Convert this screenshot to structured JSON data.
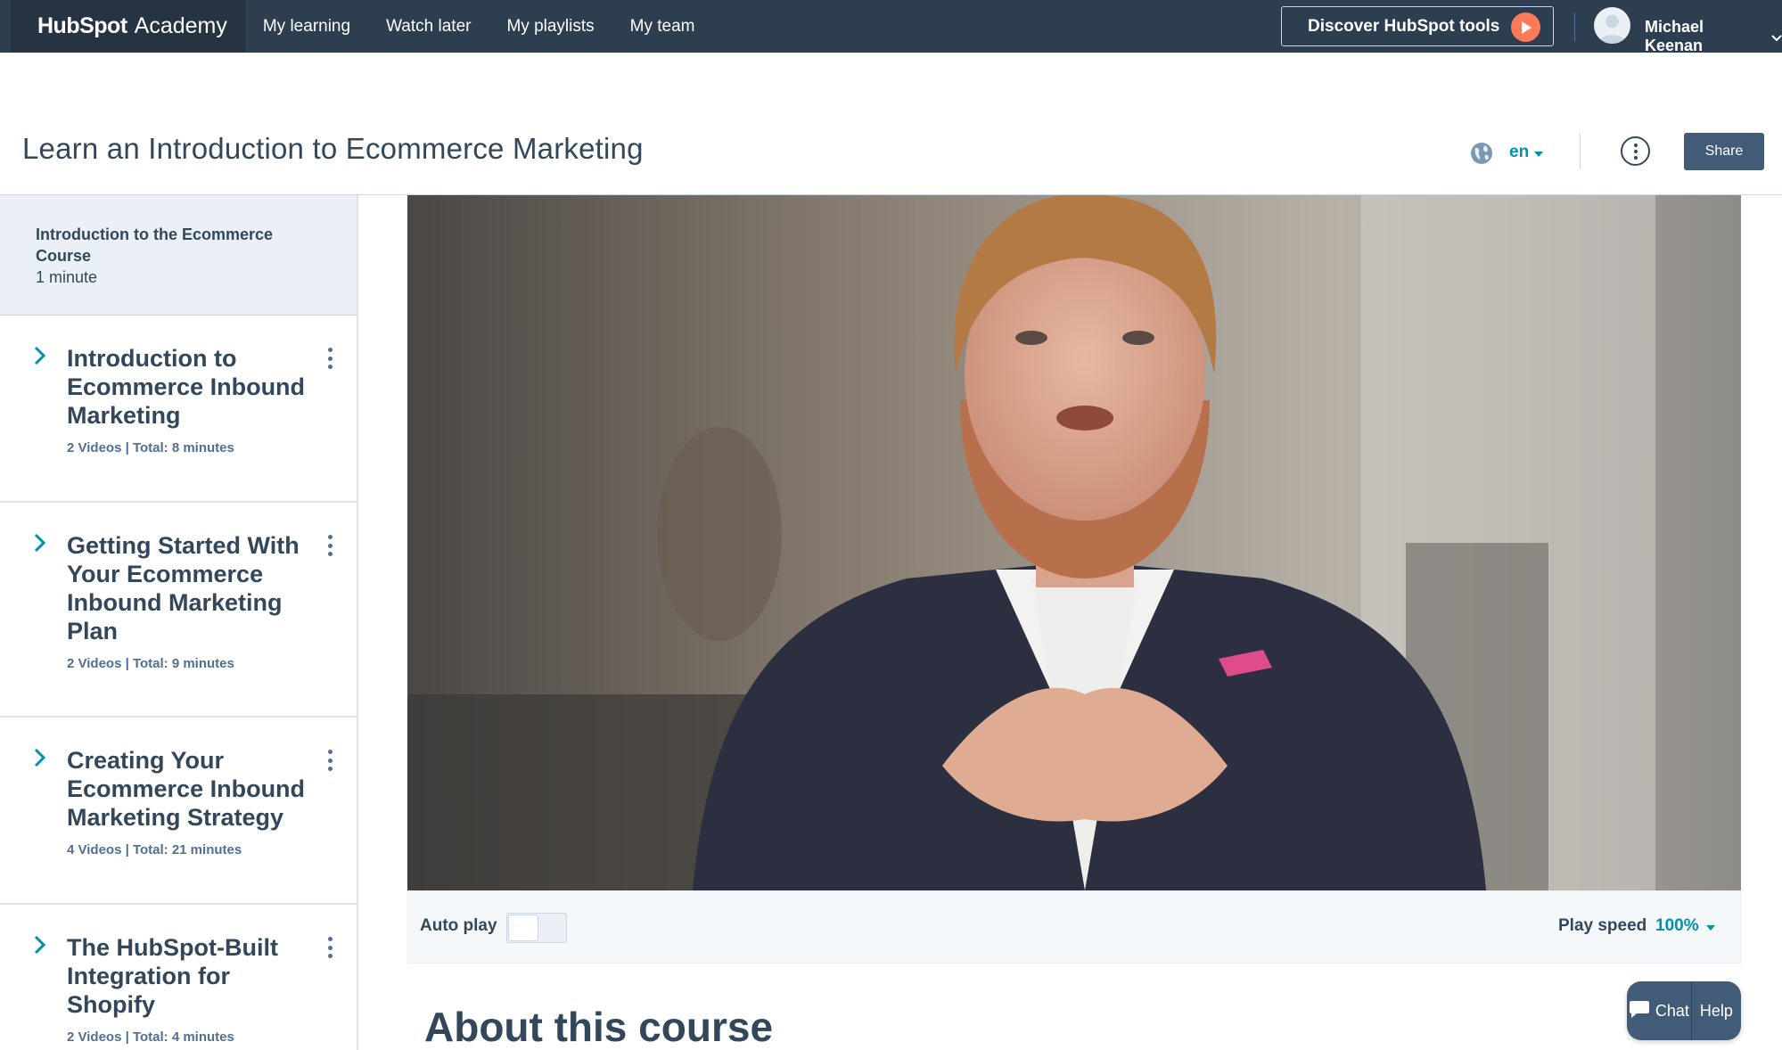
{
  "topnav": {
    "brand_strong": "HubSpot",
    "brand_light": "Academy",
    "links": [
      {
        "label": "My learning"
      },
      {
        "label": "Watch later"
      },
      {
        "label": "My playlists"
      },
      {
        "label": "My team"
      }
    ],
    "discover_label": "Discover HubSpot tools",
    "user_name": "Michael Keenan"
  },
  "header": {
    "title": "Learn an Introduction to Ecommerce Marketing",
    "language": "en",
    "share_label": "Share"
  },
  "sidebar": {
    "intro": {
      "title": "Introduction to the Ecommerce Course",
      "duration": "1 minute"
    },
    "sections": [
      {
        "title": "Introduction to Ecommerce Inbound Marketing",
        "meta": "2 Videos | Total: 8 minutes"
      },
      {
        "title": "Getting Started With Your Ecommerce Inbound Marketing Plan",
        "meta": "2 Videos | Total: 9 minutes"
      },
      {
        "title": "Creating Your Ecommerce Inbound Marketing Strategy",
        "meta": "4 Videos | Total: 21 minutes"
      },
      {
        "title": "The HubSpot-Built Integration for Shopify",
        "meta": "2 Videos | Total: 4 minutes"
      }
    ]
  },
  "player": {
    "autoplay_label": "Auto play",
    "autoplay_on": false,
    "speed_label": "Play speed",
    "speed_value": "100%"
  },
  "about_heading": "About this course",
  "chat": {
    "chat_label": "Chat",
    "help_label": "Help"
  },
  "colors": {
    "nav_bg": "#2d3e50",
    "accent_orange": "#ff7a59",
    "link_teal": "#0091ae",
    "share_bg": "#425b76"
  }
}
